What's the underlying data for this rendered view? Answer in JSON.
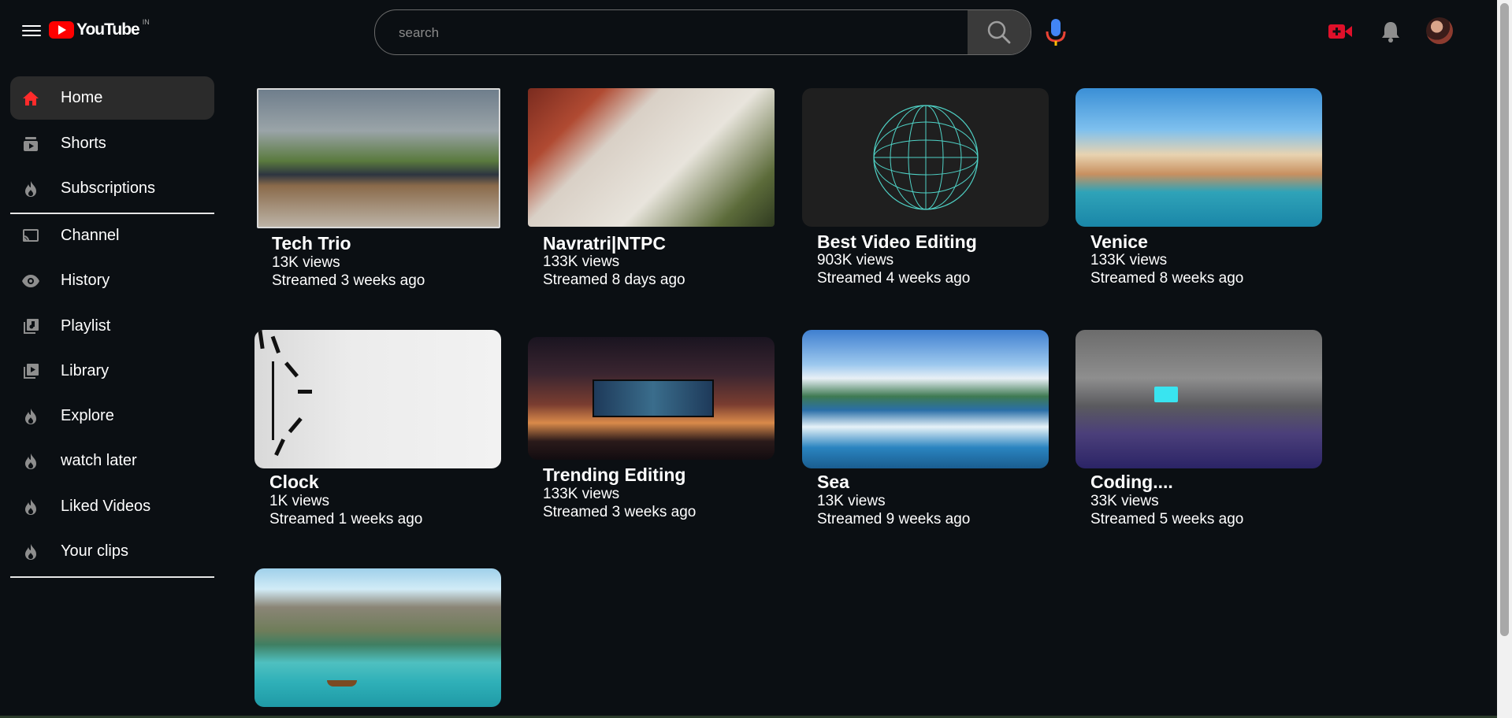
{
  "header": {
    "logo_text": "YouTube",
    "region": "IN",
    "search_placeholder": "search",
    "icons": [
      "menu-icon",
      "search-icon",
      "mic-icon",
      "create-video-icon",
      "notification-bell-icon",
      "avatar"
    ]
  },
  "sidebar": {
    "items": [
      {
        "label": "Home",
        "icon": "home-icon"
      },
      {
        "label": "Shorts",
        "icon": "shorts-icon"
      },
      {
        "label": "Subscriptions",
        "icon": "flame-icon"
      },
      {
        "label": "Channel",
        "icon": "cast-icon"
      },
      {
        "label": "History",
        "icon": "eye-icon"
      },
      {
        "label": "Playlist",
        "icon": "playlist-icon"
      },
      {
        "label": "Library",
        "icon": "library-icon"
      },
      {
        "label": "Explore",
        "icon": "flame-icon"
      },
      {
        "label": "watch later",
        "icon": "flame-icon"
      },
      {
        "label": "Liked Videos",
        "icon": "flame-icon"
      },
      {
        "label": "Your clips",
        "icon": "flame-icon"
      }
    ]
  },
  "videos": [
    {
      "title": "Tech Trio",
      "views": "13K views",
      "streamed": "Streamed 3 weeks ago"
    },
    {
      "title": "Navratri|NTPC",
      "views": "133K views",
      "streamed": "Streamed 8 days ago"
    },
    {
      "title": "Best Video Editing",
      "views": "903K views",
      "streamed": "Streamed 4 weeks ago"
    },
    {
      "title": "Venice",
      "views": "133K views",
      "streamed": "Streamed 8 weeks ago"
    },
    {
      "title": "Clock",
      "views": "1K views",
      "streamed": "Streamed 1 weeks ago"
    },
    {
      "title": "Trending Editing",
      "views": "133K views",
      "streamed": "Streamed 3 weeks ago"
    },
    {
      "title": "Sea",
      "views": "13K views",
      "streamed": "Streamed 9 weeks ago"
    },
    {
      "title": "Coding....",
      "views": "33K views",
      "streamed": "Streamed 5 weeks ago"
    },
    {
      "title": "",
      "views": "",
      "streamed": ""
    }
  ],
  "colors": {
    "background": "#0b0f13",
    "accent": "#ff0000",
    "active_item": "#2b2b2b"
  }
}
